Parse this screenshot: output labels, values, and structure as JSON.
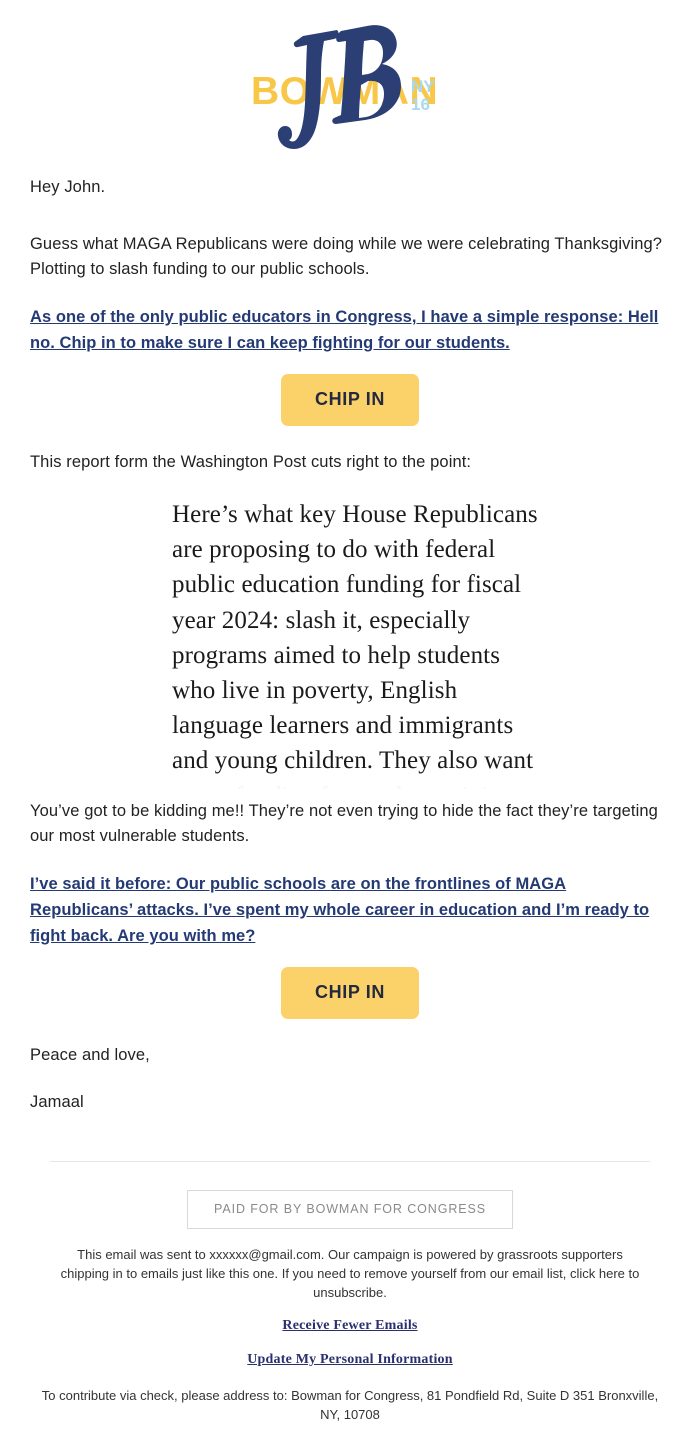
{
  "logo": {
    "wordmark": "BOWMAN",
    "monogram": "JB",
    "district": "NY 16",
    "colors": {
      "wordmark": "#f8c748",
      "monogram": "#2c3f75",
      "district": "#a9d9ee"
    }
  },
  "body": {
    "greeting": "Hey John.",
    "paragraph_1": "Guess what MAGA Republicans were doing while we were celebrating Thanksgiving? Plotting to slash funding to our public schools.",
    "link_1": "As one of the only public educators in Congress, I have a simple response: Hell no. Chip in to make sure I can keep fighting for our students.",
    "button_1": "CHIP IN",
    "paragraph_2": "This report form the Washington Post cuts right to the point:",
    "quote_lines": [
      "Here’s what key House Republicans",
      "are proposing to do with federal",
      "public education funding for fiscal",
      "year 2024: slash it, especially",
      "programs aimed to help students",
      "who live in poverty, English",
      "language learners and immigrants",
      "and young children. They also want"
    ],
    "quote_clipped_line": "to cut funding for teacher training",
    "paragraph_3": "You’ve got to be kidding me!! They’re not even trying to hide the fact they’re targeting our most vulnerable students.",
    "link_2": "I’ve said it before: Our public schools are on the frontlines of MAGA Republicans’ attacks. I’ve spent my whole career in education and I’m ready to fight back. Are you with me?",
    "button_2": "CHIP IN",
    "signoff": "Peace and love,",
    "signature": "Jamaal"
  },
  "footer": {
    "paid_for": "PAID FOR BY BOWMAN FOR CONGRESS",
    "note": "This email was sent to xxxxxx@gmail.com. Our campaign is powered by grassroots supporters chipping in to emails just like this one. If you need to remove yourself from our email list, click here to unsubscribe.",
    "link_fewer_emails": "Receive Fewer Emails",
    "link_update_info": "Update My Personal Information",
    "address": "To contribute via check, please address to: Bowman for Congress, 81 Pondfield Rd, Suite D 351 Bronxville, NY, 10708"
  },
  "colors": {
    "button_bg": "#fbd269",
    "button_text": "#24293f",
    "link_navy": "#243a74",
    "body_text": "#222222",
    "divider": "#e6e6e6"
  }
}
